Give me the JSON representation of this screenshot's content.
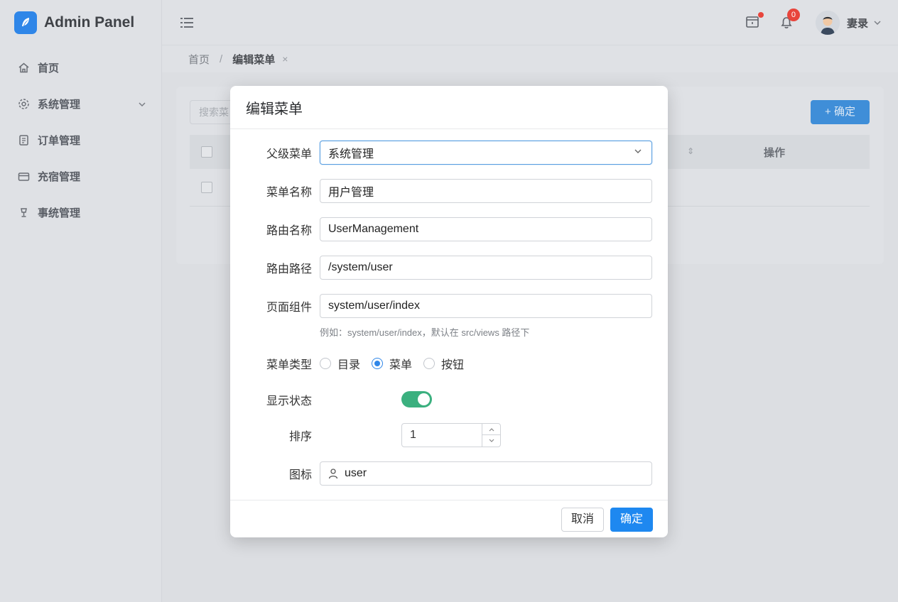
{
  "app": {
    "title": "Admin Panel"
  },
  "sidebar": {
    "items": [
      {
        "label": "首页",
        "icon": "home-icon"
      },
      {
        "label": "系统管理",
        "icon": "gear-icon",
        "expandable": true
      },
      {
        "label": "订单管理",
        "icon": "document-icon"
      },
      {
        "label": "充宿管理",
        "icon": "card-icon"
      },
      {
        "label": "事统管理",
        "icon": "lamp-icon"
      }
    ]
  },
  "header": {
    "notification_count": "0",
    "user_name": "妻录"
  },
  "breadcrumb": {
    "home": "首页",
    "separator": "/",
    "current": "编辑菜单",
    "close": "×"
  },
  "background": {
    "search_placeholder": "搜索菜",
    "add_button": "+ 确定",
    "table_column_action": "操作"
  },
  "modal": {
    "title": "编辑菜单",
    "fields": {
      "parent_menu": {
        "label": "父级菜单",
        "value": "系统管理"
      },
      "menu_name": {
        "label": "菜单名称",
        "value": "用户管理"
      },
      "route_name": {
        "label": "路由名称",
        "value": "UserManagement"
      },
      "route_path": {
        "label": "路由路径",
        "value": "/system/user"
      },
      "component": {
        "label": "页面组件",
        "value": "system/user/index",
        "hint": "例如：system/user/index，默认在 src/views 路径下"
      },
      "menu_type": {
        "label": "菜单类型",
        "options": [
          "目录",
          "菜单",
          "按钮"
        ],
        "selected": "菜单"
      },
      "visible": {
        "label": "显示状态",
        "on": true
      },
      "order": {
        "label": "排序",
        "value": "1"
      },
      "icon": {
        "label": "图标",
        "value": "user"
      }
    },
    "cancel_label": "取消",
    "confirm_label": "确定"
  },
  "colors": {
    "primary": "#1e88f0",
    "switch_on": "#3bb07f",
    "badge": "#e8453c"
  }
}
